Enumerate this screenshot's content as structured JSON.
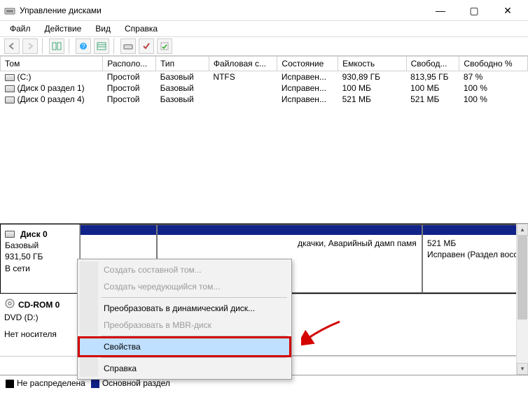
{
  "window": {
    "title": "Управление дисками",
    "min": "—",
    "max": "▢",
    "close": "✕"
  },
  "menu": {
    "file": "Файл",
    "action": "Действие",
    "view": "Вид",
    "help": "Справка"
  },
  "toolbar": {
    "back": "back-arrow-icon",
    "fwd": "forward-arrow-icon",
    "panels": "panels-icon",
    "help": "help-icon",
    "list": "list-icon",
    "disk": "disk-icon",
    "check": "check-icon",
    "tick": "tick-icon"
  },
  "columns": {
    "volume": "Том",
    "layout": "Располо...",
    "type": "Тип",
    "fs": "Файловая с...",
    "status": "Состояние",
    "capacity": "Емкость",
    "free": "Свобод...",
    "freepct": "Свободно %"
  },
  "volumes": [
    {
      "name": "(C:)",
      "layout": "Простой",
      "type": "Базовый",
      "fs": "NTFS",
      "status": "Исправен...",
      "capacity": "930,89 ГБ",
      "free": "813,95 ГБ",
      "freepct": "87 %"
    },
    {
      "name": "(Диск 0 раздел 1)",
      "layout": "Простой",
      "type": "Базовый",
      "fs": "",
      "status": "Исправен...",
      "capacity": "100 МБ",
      "free": "100 МБ",
      "freepct": "100 %"
    },
    {
      "name": "(Диск 0 раздел 4)",
      "layout": "Простой",
      "type": "Базовый",
      "fs": "",
      "status": "Исправен...",
      "capacity": "521 МБ",
      "free": "521 МБ",
      "freepct": "100 %"
    }
  ],
  "disk0": {
    "name": "Диск 0",
    "type": "Базовый",
    "size": "931,50 ГБ",
    "online": "В сети",
    "part_mid_text": "дкачки, Аварийный дамп памя",
    "part_right_size": "521 МБ",
    "part_right_status": "Исправен (Раздел восстан"
  },
  "cdrom": {
    "name": "CD-ROM 0",
    "dev": "DVD (D:)",
    "status": "Нет носителя"
  },
  "legend": {
    "unalloc": "Не распределена",
    "primary": "Основной раздел"
  },
  "context_menu": {
    "span": "Создать составной том...",
    "stripe": "Создать чередующийся том...",
    "dynamic": "Преобразовать в динамический диск...",
    "mbr": "Преобразовать в MBR-диск",
    "props": "Свойства",
    "help": "Справка"
  }
}
